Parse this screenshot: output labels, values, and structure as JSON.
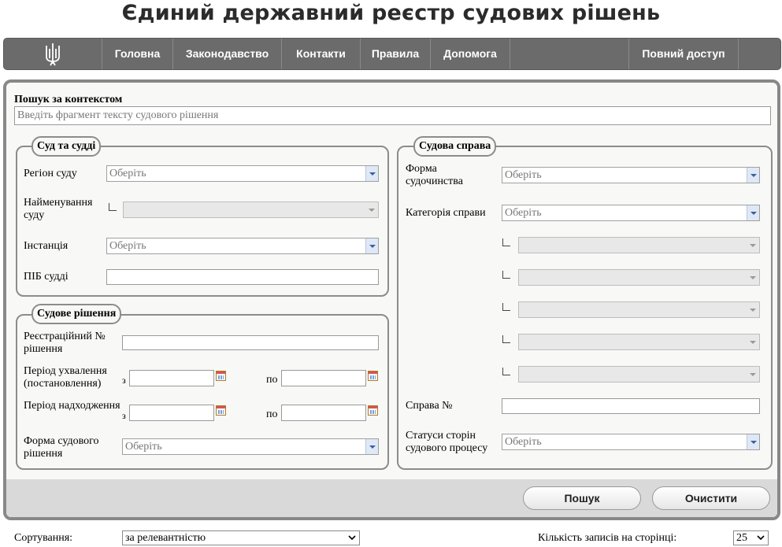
{
  "site_title": "Єдиний державний реєстр судових рішень",
  "nav": {
    "items": [
      "Головна",
      "Законодавство",
      "Контакти",
      "Правила",
      "Допомога"
    ],
    "full_access": "Повний доступ"
  },
  "context_search": {
    "label": "Пошук за контекстом",
    "placeholder": "Введіть фрагмент тексту судового рішення"
  },
  "court_judges": {
    "legend": "Суд та судді",
    "region_label": "Регіон суду",
    "region_value": "Оберіть",
    "court_name_label": "Найменування суду",
    "instance_label": "Інстанція",
    "instance_value": "Оберіть",
    "judge_label": "ПІБ судді"
  },
  "court_decision": {
    "legend": "Судове рішення",
    "reg_number_label": "Реєстраційний № рішення",
    "adoption_period_label": "Період ухвалення (постановлення)",
    "receipt_period_label": "Період надходження",
    "from_label": "з",
    "to_label": "по",
    "form_label": "Форма судового рішення",
    "form_value": "Оберіть"
  },
  "court_case": {
    "legend": "Судова справа",
    "proceeding_form_label": "Форма судочинства",
    "proceeding_form_value": "Оберіть",
    "category_label": "Категорія справи",
    "category_value": "Оберіть",
    "case_number_label": "Справа №",
    "party_status_label": "Статуси сторін судового процесу",
    "party_status_value": "Оберіть"
  },
  "buttons": {
    "search": "Пошук",
    "clear": "Очистити"
  },
  "footer": {
    "sort_label": "Сортування:",
    "sort_value": "за релевантністю",
    "per_page_label": "Кількість записів на сторінці:",
    "per_page_value": "25"
  }
}
